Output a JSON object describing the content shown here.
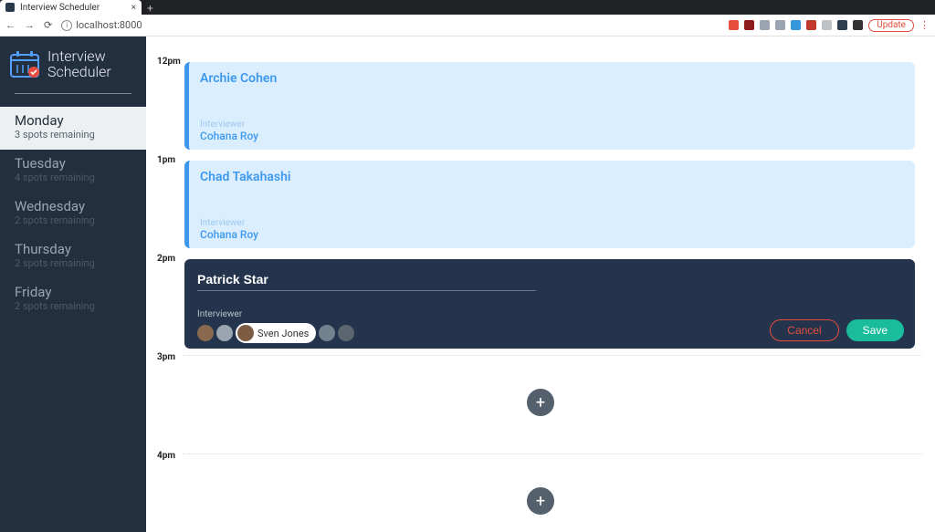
{
  "browser": {
    "tab_title": "Interview Scheduler",
    "url": "localhost:8000",
    "update_label": "Update"
  },
  "app": {
    "title_line1": "Interview",
    "title_line2": "Scheduler"
  },
  "days": [
    {
      "name": "Monday",
      "remaining": "3 spots remaining",
      "selected": true
    },
    {
      "name": "Tuesday",
      "remaining": "4 spots remaining",
      "selected": false
    },
    {
      "name": "Wednesday",
      "remaining": "2 spots remaining",
      "selected": false
    },
    {
      "name": "Thursday",
      "remaining": "2 spots remaining",
      "selected": false
    },
    {
      "name": "Friday",
      "remaining": "2 spots remaining",
      "selected": false
    }
  ],
  "hours": {
    "h12": "12pm",
    "h1": "1pm",
    "h2": "2pm",
    "h3": "3pm",
    "h4": "4pm"
  },
  "appointments": {
    "slot12": {
      "student": "Archie Cohen",
      "interviewer_label": "Interviewer",
      "interviewer": "Cohana Roy"
    },
    "slot1": {
      "student": "Chad Takahashi",
      "interviewer_label": "Interviewer",
      "interviewer": "Cohana Roy"
    },
    "slot2_form": {
      "name_value": "Patrick Star",
      "interviewer_label": "Interviewer",
      "selected_interviewer": "Sven Jones",
      "cancel_label": "Cancel",
      "save_label": "Save"
    }
  },
  "interviewer_avatars": {
    "a1": "#88694f",
    "a2": "#9aa5b1",
    "a3_selected": "#7c5c42",
    "a4": "#72838f",
    "a5": "#5b6670"
  }
}
